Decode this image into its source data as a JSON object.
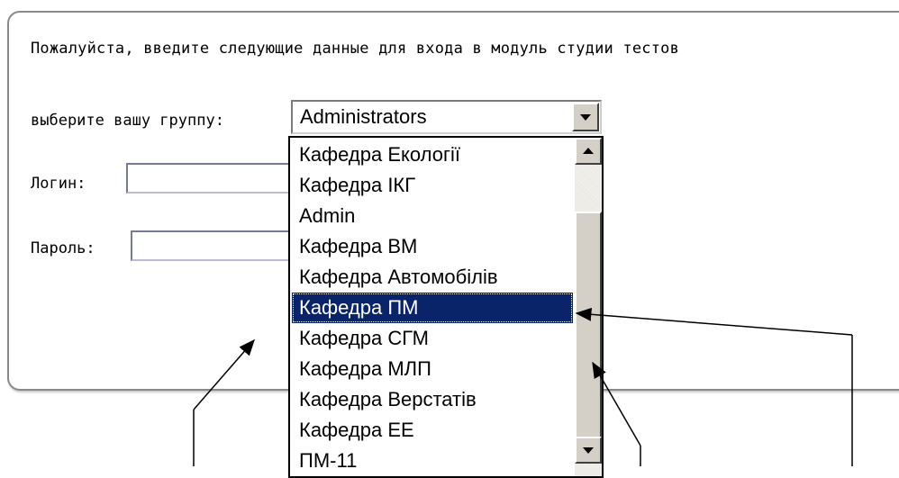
{
  "form": {
    "intro": "Пожалуйста, введите следующие данные для входа в модуль студии тестов",
    "group_label": "выберите вашу группу:",
    "group_selected": "Administrators",
    "login_label": "Логин:",
    "password_label": "Пароль:",
    "group_options": [
      "Кафедра Екології",
      "Кафедра ІКГ",
      "Admin",
      "Кафедра ВМ",
      "Кафедра Автомобілів",
      "Кафедра ПМ",
      "Кафедра СГМ",
      "Кафедра МЛП",
      "Кафедра Верстатів",
      "Кафедра ЕЕ",
      "ПМ-11"
    ],
    "highlighted_option": "Кафедра ПМ"
  },
  "colors": {
    "highlight": "#0a246a",
    "panel_border": "#8a8a8a",
    "field_border": "#767a96"
  },
  "icons": [
    "dropdown-arrow-icon",
    "scroll-up-icon",
    "scroll-down-icon"
  ]
}
